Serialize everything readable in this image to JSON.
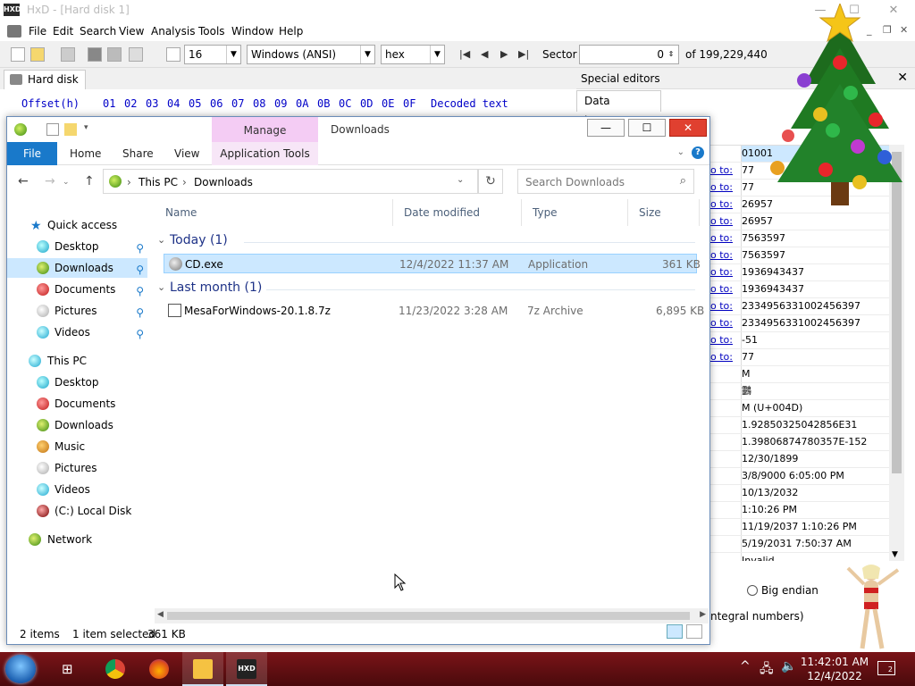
{
  "hxd": {
    "title": "HxD - [Hard disk 1]",
    "logo_text": "HXD",
    "menu": [
      "File",
      "Edit",
      "Search",
      "View",
      "Analysis",
      "Tools",
      "Window",
      "Help"
    ],
    "bytes_per_row": "16",
    "charset": "Windows (ANSI)",
    "display": "hex",
    "sector_label": "Sector",
    "sector_value": "0",
    "sector_total": "of 199,229,440",
    "tab_label": "Hard disk 1",
    "offset_label": "Offset(h)",
    "hex_columns": [
      "01",
      "02",
      "03",
      "04",
      "05",
      "06",
      "07",
      "08",
      "09",
      "0A",
      "0B",
      "0C",
      "0D",
      "0E",
      "0F"
    ],
    "decoded_label": "Decoded text",
    "special_editors": "Special editors",
    "data_inspector": "Data inspector",
    "inspector_goto_label": "o to:",
    "inspector_values": [
      "01001",
      "77",
      "77",
      "26957",
      "26957",
      "7563597",
      "7563597",
      "1936943437",
      "1936943437",
      "2334956331002456397",
      "2334956331002456397",
      "-51",
      "77",
      "M",
      "䴒",
      "M (U+004D)",
      "1.92850325042856E31",
      "1.39806874780357E-152",
      "12/30/1899",
      "3/8/9000 6:05:00 PM",
      "10/13/2032",
      "1:10:26 PM",
      "11/19/2037 1:10:26 PM",
      "5/19/2031 7:50:37 AM",
      "Invalid"
    ],
    "big_endian": "Big endian",
    "integral_numbers": "ntegral numbers)"
  },
  "explorer": {
    "manage_tab": "Manage",
    "title": "Downloads",
    "ribbon_tabs": [
      "File",
      "Home",
      "Share",
      "View",
      "Application Tools"
    ],
    "breadcrumb": [
      "This PC",
      "Downloads"
    ],
    "search_placeholder": "Search Downloads",
    "nav": {
      "quick_access": "Quick access",
      "quick_items": [
        "Desktop",
        "Downloads",
        "Documents",
        "Pictures",
        "Videos"
      ],
      "this_pc": "This PC",
      "pc_items": [
        "Desktop",
        "Documents",
        "Downloads",
        "Music",
        "Pictures",
        "Videos",
        "(C:) Local Disk"
      ],
      "network": "Network"
    },
    "columns": [
      "Name",
      "Date modified",
      "Type",
      "Size"
    ],
    "groups": [
      {
        "label": "Today (1)",
        "files": [
          {
            "name": "CD.exe",
            "date": "12/4/2022 11:37 AM",
            "type": "Application",
            "size": "361 KB",
            "selected": true
          }
        ]
      },
      {
        "label": "Last month (1)",
        "files": [
          {
            "name": "MesaForWindows-20.1.8.7z",
            "date": "11/23/2022 3:28 AM",
            "type": "7z Archive",
            "size": "6,895 KB",
            "selected": false
          }
        ]
      }
    ],
    "status": {
      "items": "2 items",
      "selected": "1 item selected",
      "size": "361 KB"
    }
  },
  "taskbar": {
    "time": "11:42:01 AM",
    "date": "12/4/2022",
    "hxd_label": "HXD",
    "notif_count": "2"
  },
  "colors": {
    "accent": "#1979ca",
    "manage_tab": "#f4ccf4",
    "selection": "#cce8ff",
    "hex_text": "#0000c8",
    "taskbar": "#6a1014",
    "close_button": "#e04030"
  }
}
